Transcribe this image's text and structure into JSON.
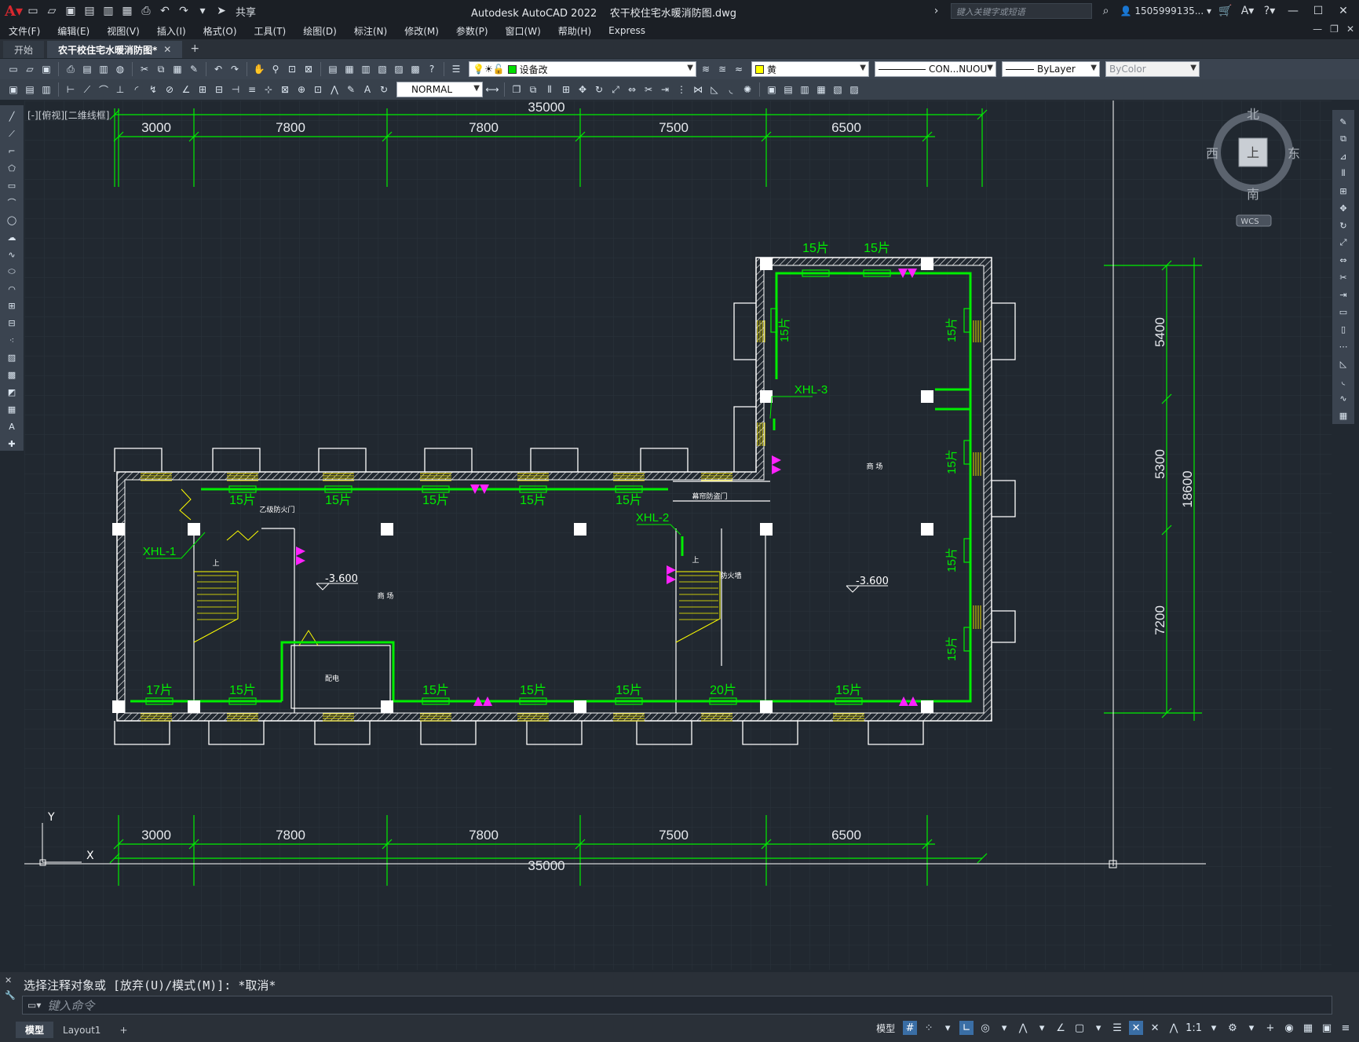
{
  "app": {
    "title": "Autodesk AutoCAD 2022",
    "file": "农干校住宅水暖消防图.dwg",
    "share": "共享",
    "search_placeholder": "键入关键字或短语",
    "user": "1505999135..."
  },
  "menu": [
    "文件(F)",
    "编辑(E)",
    "视图(V)",
    "插入(I)",
    "格式(O)",
    "工具(T)",
    "绘图(D)",
    "标注(N)",
    "修改(M)",
    "参数(P)",
    "窗口(W)",
    "帮助(H)",
    "Express"
  ],
  "tabs": {
    "start": "开始",
    "active": "农干校住宅水暖消防图*"
  },
  "toolbar": {
    "layer": "设备改",
    "layer_color": "#00dd00",
    "color": "黄",
    "color_swatch": "#ffff00",
    "linetype": "CON...NUOU",
    "lineweight": "ByLayer",
    "plotstyle": "ByColor",
    "textstyle": "NORMAL"
  },
  "viewport": {
    "label": "[-][俯视][二维线框]"
  },
  "viewcube": {
    "north": "北",
    "south": "南",
    "east": "东",
    "west": "西",
    "top": "上",
    "wcs": "WCS"
  },
  "drawing": {
    "dims_top": [
      "3000",
      "7800",
      "7800",
      "7500",
      "6500"
    ],
    "dims_total": "35000",
    "dims_bottom": [
      "3000",
      "7800",
      "7800",
      "7500",
      "6500"
    ],
    "dims_right": [
      "5400",
      "5300",
      "7200"
    ],
    "dims_right_total": "18600",
    "radiators_top_left": [
      "15片",
      "15片",
      "15片",
      "15片",
      "15片"
    ],
    "radiators_top_right": [
      "15片",
      "15片"
    ],
    "radiators_bottom": [
      "17片",
      "15片",
      "15片",
      "15片",
      "15片",
      "20片",
      "15片"
    ],
    "radiators_vertical": [
      "15片",
      "15片",
      "15片",
      "15片",
      "15片"
    ],
    "risers": [
      "XHL-1",
      "XHL-2",
      "XHL-3"
    ],
    "elevations": [
      "-3.600",
      "-3.600"
    ],
    "rooms": [
      "商 场",
      "商 场",
      "配电",
      "防火墙",
      "乙级防火门",
      "幕帘防盗门",
      "上",
      "上"
    ],
    "axes": [
      "Y",
      "X"
    ]
  },
  "command": {
    "history": "选择注释对象或 [放弃(U)/模式(M)]: *取消*",
    "placeholder": "键入命令"
  },
  "status": {
    "tabs": [
      "模型",
      "Layout1"
    ],
    "model_label": "模型",
    "scale": "1:1"
  }
}
